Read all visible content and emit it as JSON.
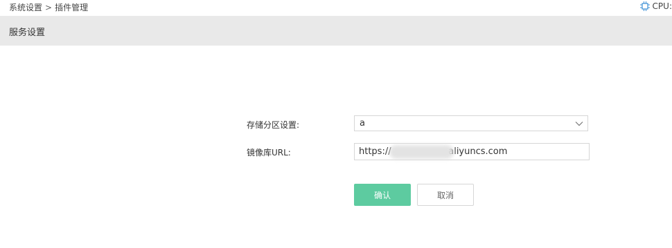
{
  "breadcrumb": {
    "items": [
      "系统设置",
      "插件管理"
    ],
    "separator": ">"
  },
  "status": {
    "cpu_label": "CPU:",
    "icon": "cpu-chip-icon"
  },
  "section": {
    "title": "服务设置"
  },
  "form": {
    "storage_partition": {
      "label": "存储分区设置:",
      "selected": "a",
      "icon": "chevron-down-icon"
    },
    "registry_url": {
      "label": "镜像库URL:",
      "value": "https://                    aliyuncs.com"
    }
  },
  "actions": {
    "confirm_label": "确认",
    "cancel_label": "取消"
  },
  "colors": {
    "header_bg": "#e9e9e9",
    "primary": "#5dcba0",
    "icon_blue": "#3b8fd6",
    "border": "#d6d6d6"
  }
}
